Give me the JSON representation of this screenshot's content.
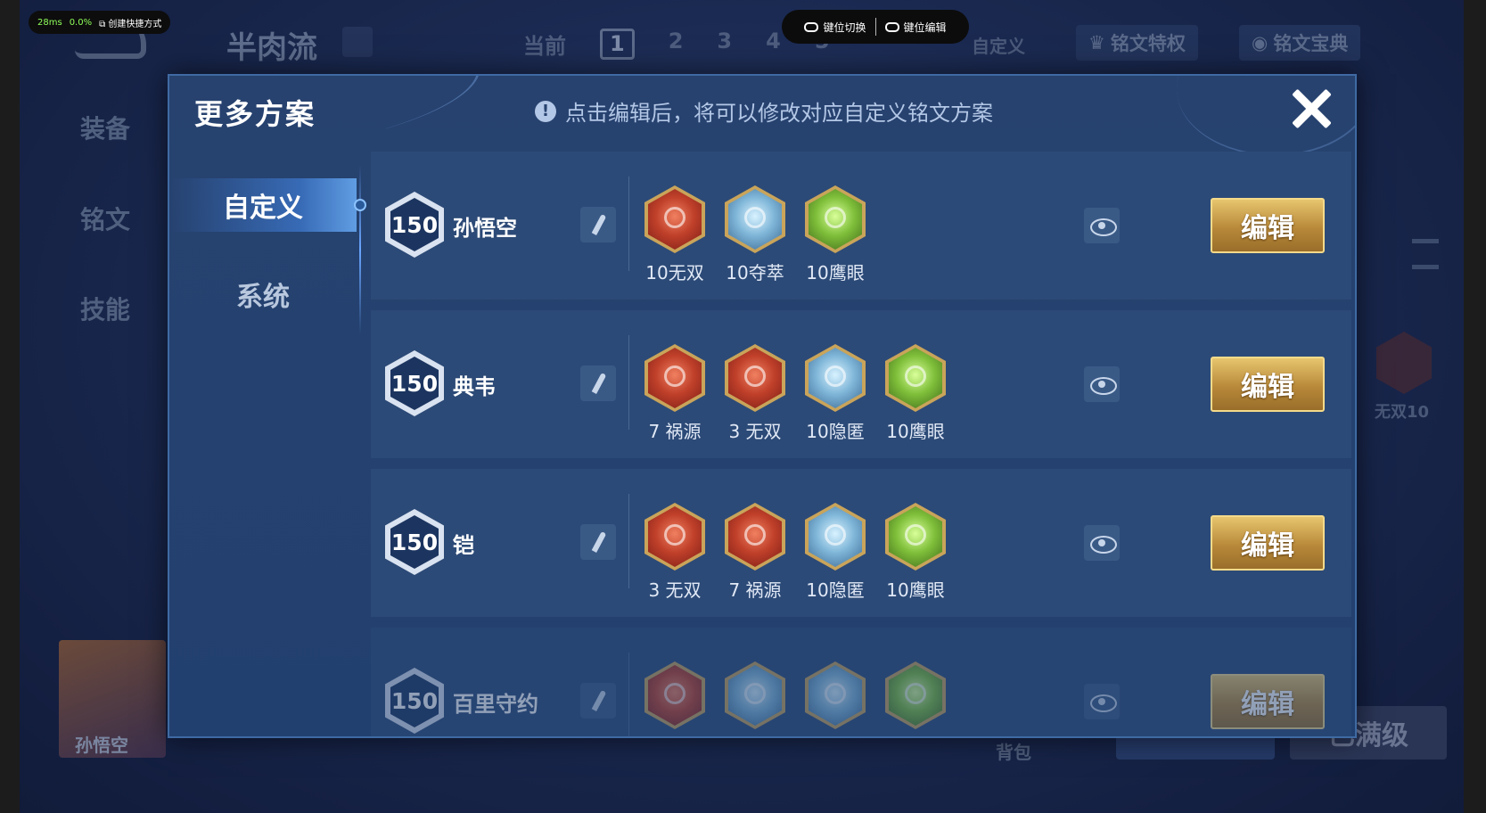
{
  "overlay": {
    "latency": "28ms",
    "loss": "0.0%",
    "shortcut_label": "创建快捷方式",
    "keymap_switch": "键位切换",
    "keymap_edit": "键位编辑"
  },
  "background": {
    "title": "半肉流",
    "tabs": [
      "当前",
      "1",
      "2",
      "3",
      "4",
      "5"
    ],
    "custom_label": "自定义",
    "rune_privilege": "铭文特权",
    "rune_codex": "铭文宝典",
    "side_menu": [
      "装备",
      "铭文",
      "技能"
    ],
    "hero_name": "孙悟空",
    "bag_label": "背包",
    "max_label": "已满级",
    "rune_preview_label": "无双10"
  },
  "modal": {
    "title": "更多方案",
    "hint_icon": "info-icon",
    "hint": "点击编辑后，将可以修改对应自定义铭文方案",
    "nav": [
      {
        "label": "自定义",
        "active": true
      },
      {
        "label": "系统",
        "active": false
      }
    ],
    "edit_label": "编辑",
    "rows": [
      {
        "level": "150",
        "hero": "孙悟空",
        "runes": [
          {
            "color": "red",
            "label": "10无双"
          },
          {
            "color": "blue",
            "label": "10夺萃"
          },
          {
            "color": "green",
            "label": "10鹰眼"
          }
        ]
      },
      {
        "level": "150",
        "hero": "典韦",
        "runes": [
          {
            "color": "red",
            "label": "7 祸源"
          },
          {
            "color": "red",
            "label": "3 无双"
          },
          {
            "color": "blue",
            "label": "10隐匿"
          },
          {
            "color": "green",
            "label": "10鹰眼"
          }
        ]
      },
      {
        "level": "150",
        "hero": "铠",
        "runes": [
          {
            "color": "red",
            "label": "3 无双"
          },
          {
            "color": "red",
            "label": "7 祸源"
          },
          {
            "color": "blue",
            "label": "10隐匿"
          },
          {
            "color": "green",
            "label": "10鹰眼"
          }
        ]
      },
      {
        "level": "150",
        "hero": "百里守约",
        "runes": [
          {
            "color": "red",
            "label": ""
          },
          {
            "color": "blue",
            "label": ""
          },
          {
            "color": "blue",
            "label": ""
          },
          {
            "color": "green",
            "label": ""
          }
        ]
      }
    ]
  }
}
